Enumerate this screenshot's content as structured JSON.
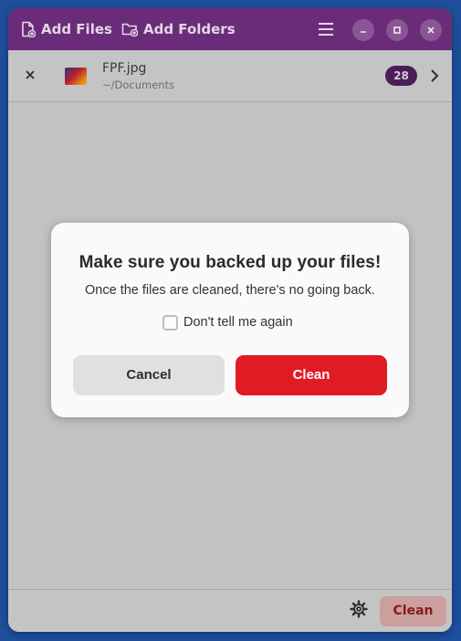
{
  "header": {
    "add_files_label": "Add Files",
    "add_folders_label": "Add Folders",
    "accent_color": "#6a2c78"
  },
  "file": {
    "name": "FPF.jpg",
    "path": "~/Documents",
    "metadata_count": "28"
  },
  "dialog": {
    "title": "Make sure you backed up your files!",
    "body": "Once the files are cleaned, there's no going back.",
    "checkbox_label": "Don't tell me again",
    "checkbox_checked": false,
    "cancel_label": "Cancel",
    "clean_label": "Clean",
    "destructive_color": "#e01b24"
  },
  "bottom_bar": {
    "clean_label": "Clean"
  },
  "icons": {
    "add_files": "file-add-icon",
    "add_folders": "folder-add-icon",
    "menu": "hamburger-menu-icon",
    "minimize": "minimize-icon",
    "maximize": "maximize-icon",
    "close": "close-icon",
    "remove_file": "remove-x-icon",
    "details": "chevron-right-icon",
    "settings": "gear-icon"
  }
}
